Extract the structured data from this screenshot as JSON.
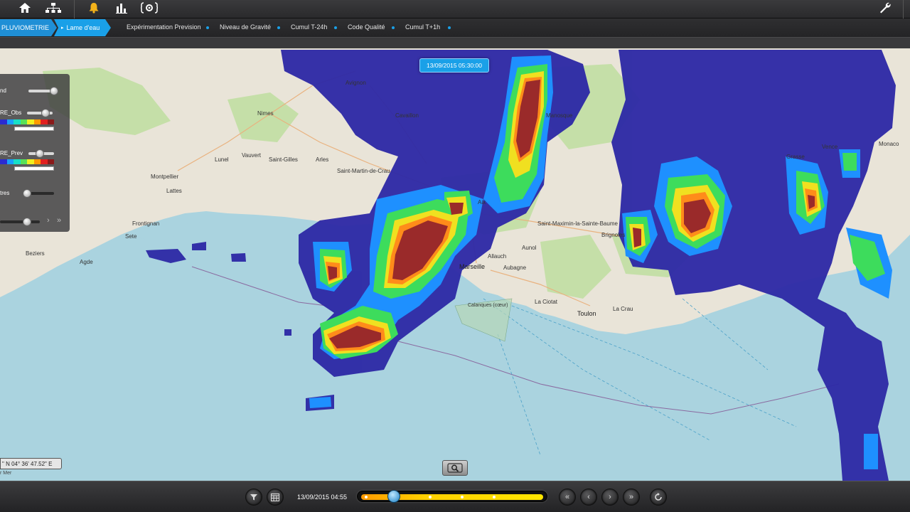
{
  "toolbar": {
    "icons": [
      "home-icon",
      "sitemap-icon",
      "bell-icon",
      "chart-icon",
      "settings-icon",
      "wrench-icon"
    ]
  },
  "tabs": {
    "main_label": "PLUVIOMETRIE",
    "sub_label": "Lame d'eau",
    "items": [
      "Expérimentation Prevision",
      "Niveau de Gravité",
      "Cumul T-24h",
      "Code Qualité",
      "Cumul T+1h"
    ]
  },
  "map": {
    "date_badge": "13/09/2015 05:30:00",
    "coordinates": "\" N 04° 36' 47.52\" E",
    "attribution": "r Mer",
    "places": [
      "Avignon",
      "Nimes",
      "Montpellier",
      "Lattes",
      "Lunel",
      "Vauvert",
      "Saint-Gilles",
      "Arles",
      "Saint-Martin-de-Crau",
      "Frontignan",
      "Sete",
      "Agde",
      "Beziers",
      "Marseille",
      "Aubagne",
      "Allauch",
      "Aix",
      "Manosque",
      "Saint-Maximin-la-Sainte-Baume",
      "Aunol",
      "Brignoles",
      "La Ciotat",
      "Toulon",
      "La Crau",
      "Cavaillon",
      "Monaco",
      "Vence",
      "Grasse",
      "Calanques (cœur)"
    ]
  },
  "layers": {
    "items": [
      {
        "label": "nd",
        "value": 0.9
      },
      {
        "label": "RE_Obs",
        "value": 0.7
      },
      {
        "label": "RE_Prev",
        "value": 0.7
      },
      {
        "label": "tres",
        "value": 0.25
      },
      {
        "label": "",
        "value": 0.55
      }
    ],
    "legend_colors": [
      "#2b2bd0",
      "#1aa0ff",
      "#18e0c8",
      "#58e058",
      "#f0f020",
      "#ff9a00",
      "#e02020",
      "#8a1a1a"
    ]
  },
  "bottombar": {
    "date": "13/09/2015 04:55",
    "timeline_position": 0.17,
    "buttons": [
      "filter-icon",
      "calendar-icon",
      "first-icon",
      "prev-icon",
      "next-icon",
      "last-icon",
      "refresh-icon"
    ]
  }
}
